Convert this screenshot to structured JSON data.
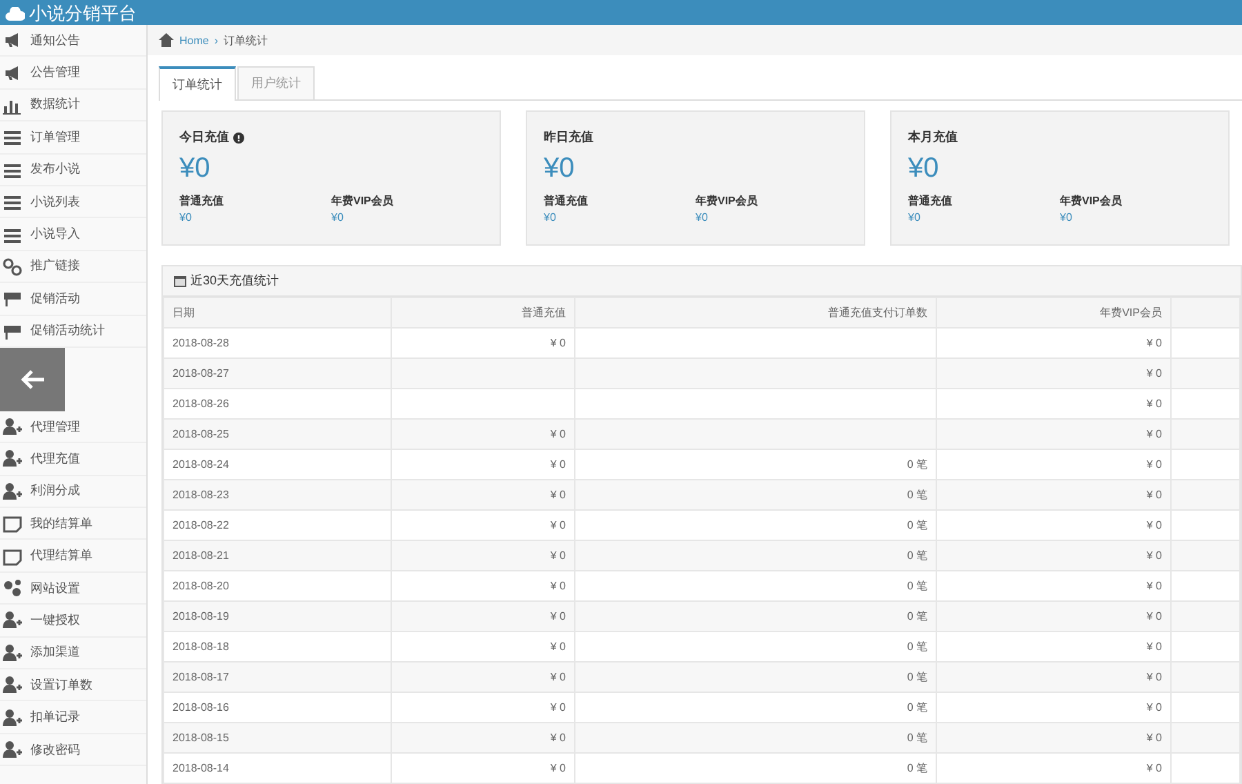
{
  "header": {
    "title": "小说分销平台"
  },
  "sidebar": {
    "items": [
      {
        "label": "通知公告",
        "kind": "bullhorn"
      },
      {
        "label": "公告管理",
        "kind": "bullhorn"
      },
      {
        "label": "数据统计",
        "kind": "chart"
      },
      {
        "label": "订单管理",
        "kind": "list"
      },
      {
        "label": "发布小说",
        "kind": "list"
      },
      {
        "label": "小说列表",
        "kind": "list"
      },
      {
        "label": "小说导入",
        "kind": "list"
      },
      {
        "label": "推广链接",
        "kind": "link"
      },
      {
        "label": "促销活动",
        "kind": "flag"
      },
      {
        "label": "促销活动统计",
        "kind": "flag"
      },
      {
        "kind": "back"
      },
      {
        "label": "代理管理",
        "kind": "user"
      },
      {
        "label": "代理充值",
        "kind": "user"
      },
      {
        "label": "利润分成",
        "kind": "user"
      },
      {
        "label": "我的结算单",
        "kind": "note"
      },
      {
        "label": "代理结算单",
        "kind": "note"
      },
      {
        "label": "网站设置",
        "kind": "gear"
      },
      {
        "label": "一键授权",
        "kind": "user"
      },
      {
        "label": "添加渠道",
        "kind": "user"
      },
      {
        "label": "设置订单数",
        "kind": "user"
      },
      {
        "label": "扣单记录",
        "kind": "user"
      },
      {
        "label": "修改密码",
        "kind": "user"
      }
    ]
  },
  "breadcrumb": {
    "home": "Home",
    "separator": "›",
    "current": "订单统计"
  },
  "tabs": [
    {
      "label": "订单统计",
      "selected": true
    },
    {
      "label": "用户统计",
      "selected": false
    }
  ],
  "cards": [
    {
      "title": "今日充值",
      "help": true,
      "amount": "¥0",
      "stats": [
        {
          "label": "普通充值",
          "value": "¥0"
        },
        {
          "label": "年费VIP会员",
          "value": "¥0"
        }
      ]
    },
    {
      "title": "昨日充值",
      "help": false,
      "amount": "¥0",
      "stats": [
        {
          "label": "普通充值",
          "value": "¥0"
        },
        {
          "label": "年费VIP会员",
          "value": "¥0"
        }
      ]
    },
    {
      "title": "本月充值",
      "help": false,
      "amount": "¥0",
      "stats": [
        {
          "label": "普通充值",
          "value": "¥0"
        },
        {
          "label": "年费VIP会员",
          "value": "¥0"
        }
      ]
    }
  ],
  "table": {
    "title": "近30天充值统计",
    "columns": [
      "日期",
      "普通充值",
      "普通充值支付订单数",
      "年费VIP会员"
    ],
    "rows": [
      [
        "2018-08-28",
        "¥ 0",
        null,
        "¥ 0"
      ],
      [
        "2018-08-27",
        null,
        null,
        "¥ 0"
      ],
      [
        "2018-08-26",
        null,
        null,
        "¥ 0"
      ],
      [
        "2018-08-25",
        "¥ 0",
        null,
        "¥ 0"
      ],
      [
        "2018-08-24",
        "¥ 0",
        "0 笔",
        "¥ 0"
      ],
      [
        "2018-08-23",
        "¥ 0",
        "0 笔",
        "¥ 0"
      ],
      [
        "2018-08-22",
        "¥ 0",
        "0 笔",
        "¥ 0"
      ],
      [
        "2018-08-21",
        "¥ 0",
        "0 笔",
        "¥ 0"
      ],
      [
        "2018-08-20",
        "¥ 0",
        "0 笔",
        "¥ 0"
      ],
      [
        "2018-08-19",
        "¥ 0",
        "0 笔",
        "¥ 0"
      ],
      [
        "2018-08-18",
        "¥ 0",
        "0 笔",
        "¥ 0"
      ],
      [
        "2018-08-17",
        "¥ 0",
        "0 笔",
        "¥ 0"
      ],
      [
        "2018-08-16",
        "¥ 0",
        "0 笔",
        "¥ 0"
      ],
      [
        "2018-08-15",
        "¥ 0",
        "0 笔",
        "¥ 0"
      ],
      [
        "2018-08-14",
        "¥ 0",
        "0 笔",
        "¥ 0"
      ]
    ]
  }
}
